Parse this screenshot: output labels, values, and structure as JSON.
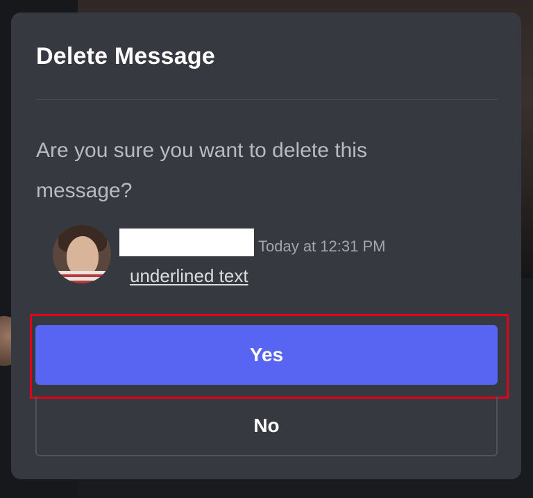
{
  "dialog": {
    "title": "Delete Message",
    "question": "Are you sure you want to delete this message?",
    "preview": {
      "timestamp": "Today at 12:31 PM",
      "message": "underlined text"
    },
    "buttons": {
      "yes": "Yes",
      "no": "No"
    }
  },
  "colors": {
    "accent": "#5865f2",
    "dialog_bg": "#36393f",
    "highlight": "#e3001b"
  }
}
